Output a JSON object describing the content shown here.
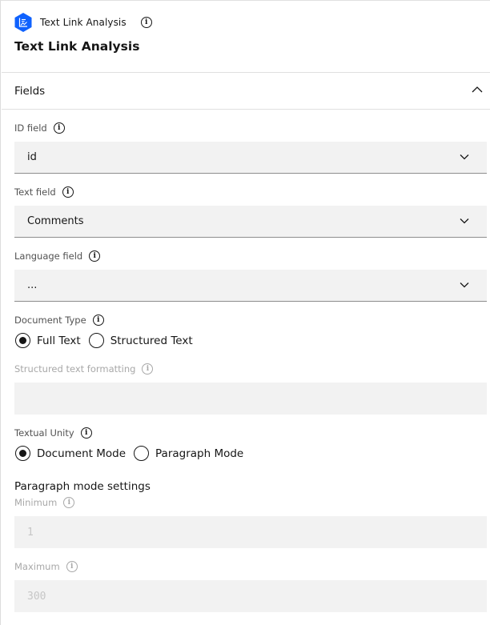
{
  "header": {
    "node_name": "Text Link Analysis",
    "title": "Text Link Analysis",
    "logo_icon": "text-link-analysis-hexagon-icon",
    "info_icon": "info-icon",
    "brand_color": "#0f62fe"
  },
  "section": {
    "label": "Fields",
    "expanded": true,
    "toggle_icon": "chevron-up-icon"
  },
  "fields": {
    "id_field": {
      "label": "ID field",
      "value": "id"
    },
    "text_field": {
      "label": "Text field",
      "value": "Comments"
    },
    "language_field": {
      "label": "Language field",
      "value": "..."
    }
  },
  "document_type": {
    "label": "Document Type",
    "options": [
      {
        "label": "Full Text",
        "selected": true
      },
      {
        "label": "Structured Text",
        "selected": false
      }
    ]
  },
  "structured_text_formatting": {
    "label": "Structured text formatting",
    "value": "",
    "disabled": true
  },
  "textual_unity": {
    "label": "Textual Unity",
    "options": [
      {
        "label": "Document Mode",
        "selected": true
      },
      {
        "label": "Paragraph Mode",
        "selected": false
      }
    ]
  },
  "paragraph_mode_settings": {
    "heading": "Paragraph mode settings",
    "minimum": {
      "label": "Minimum",
      "value": "1",
      "disabled": true
    },
    "maximum": {
      "label": "Maximum",
      "value": "300",
      "disabled": true
    }
  }
}
